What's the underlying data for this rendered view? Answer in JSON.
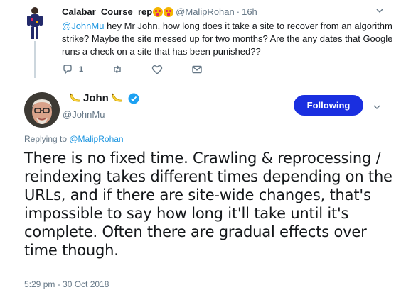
{
  "reply": {
    "name": "Calabar_Course_rep",
    "handle": "@MalipRohan",
    "separator": "·",
    "time": "16h",
    "mention": "@JohnMu",
    "text": " hey Mr John, how long does it take a site to recover from an algorithm strike?  Maybe the site messed up for two months?  Are the any dates that Google runs a check on a site that has been punished??",
    "actions": {
      "reply_count": "1"
    },
    "icons": [
      "reply-icon",
      "retweet-icon",
      "like-icon",
      "message-icon",
      "chevron-down-icon"
    ]
  },
  "tweet": {
    "name": "John",
    "handle": "@JohnMu",
    "follow_label": "Following",
    "replying_prefix": "Replying to ",
    "replying_to": "@MalipRohan",
    "text": "There is no fixed time. Crawling & reprocessing / reindexing takes different times depending on the URLs, and if there are site-wide changes, that's impossible to say how long it'll take until it's complete. Often there are gradual effects over time though.",
    "timestamp": "5:29 pm - 30 Oct 2018",
    "icons": [
      "banana-icon",
      "verified-icon",
      "chevron-down-icon"
    ]
  },
  "colors": {
    "link": "#1b95e0",
    "muted": "#657786",
    "button": "#1a2fe0",
    "thread_line": "#ccd6dd"
  }
}
